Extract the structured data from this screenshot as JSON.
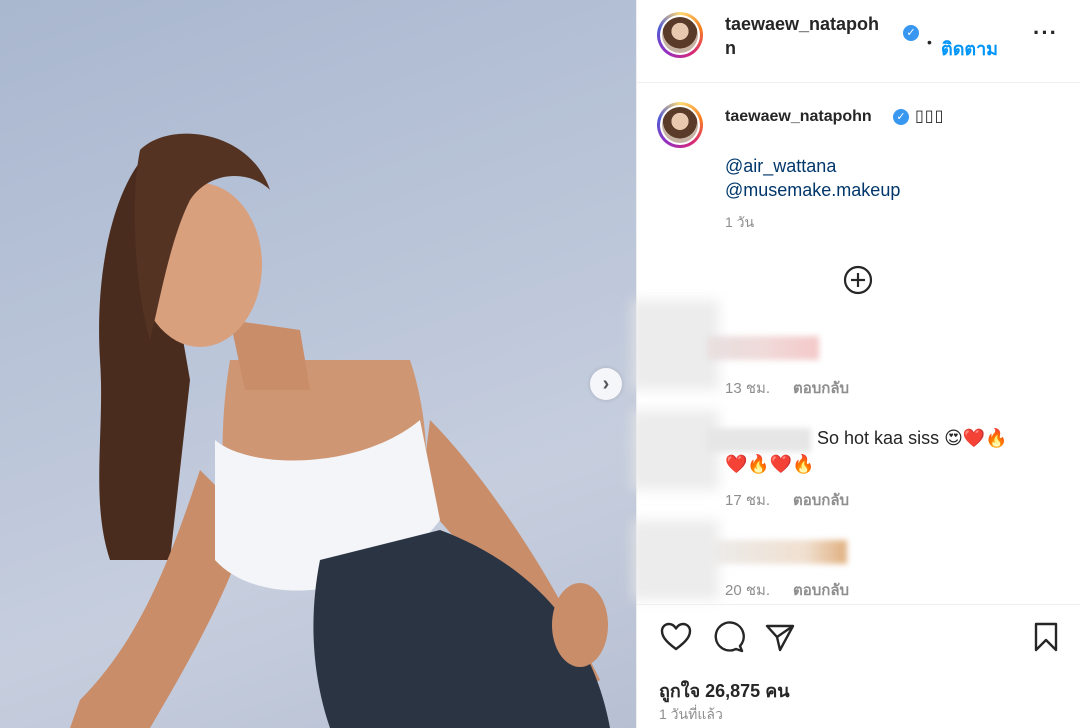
{
  "post": {
    "username": "taewaew_natapohn",
    "header_username_line1": "taewaew_natapoh",
    "header_username_line2": "n",
    "verified_glyph": "✓",
    "follow_dot": "•",
    "follow_label": "ติดตาม",
    "more_label": "···",
    "caption_boxes": "▯▯▯",
    "mentions": [
      "@air_wattana",
      "@musemake.makeup"
    ],
    "caption_time": "1 วัน",
    "next_icon": "›",
    "likes_label": "ถูกใจ 26,875 คน",
    "post_time": "1 วันที่แล้ว"
  },
  "comments": [
    {
      "text": "",
      "time": "13 ชม.",
      "reply": "ตอบกลับ"
    },
    {
      "text": "So hot kaa siss 😍❤️🔥",
      "text2": "❤️🔥❤️🔥",
      "time": "17 ชม.",
      "reply": "ตอบกลับ"
    },
    {
      "text": "",
      "time": "20 ชม.",
      "reply": "ตอบกลับ"
    }
  ],
  "icons": {
    "like": "heart-icon",
    "comment": "comment-icon",
    "share": "share-icon",
    "save": "bookmark-icon",
    "more_comments": "plus-circle-icon",
    "next": "chevron-right-icon",
    "more": "more-options-icon",
    "verified": "verified-badge-icon"
  },
  "colors": {
    "follow": "#0095f6",
    "mention": "#00376b",
    "verified": "#3897f0",
    "muted": "#8e8e8e"
  }
}
